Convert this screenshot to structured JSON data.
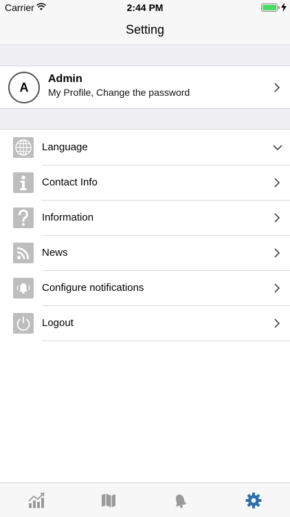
{
  "status": {
    "carrier": "Carrier",
    "time": "2:44 PM"
  },
  "nav": {
    "title": "Setting"
  },
  "profile": {
    "initial": "A",
    "name": "Admin",
    "subtitle": "My Profile, Change the password"
  },
  "menu": [
    {
      "label": "Language",
      "icon": "globe-icon"
    },
    {
      "label": "Contact Info",
      "icon": "info-icon"
    },
    {
      "label": "Information",
      "icon": "question-icon"
    },
    {
      "label": "News",
      "icon": "rss-icon"
    },
    {
      "label": "Configure notifications",
      "icon": "bell-icon"
    },
    {
      "label": "Logout",
      "icon": "power-icon"
    }
  ],
  "tabs": [
    {
      "name": "stats",
      "icon": "chart-icon",
      "active": false
    },
    {
      "name": "map",
      "icon": "map-icon",
      "active": false
    },
    {
      "name": "alerts",
      "icon": "bell-icon",
      "active": false
    },
    {
      "name": "settings",
      "icon": "gear-icon",
      "active": true
    }
  ],
  "colors": {
    "accent": "#2a6fb0",
    "inactive_icon": "#9a9a9a",
    "menu_icon_bg": "#bdbdbd",
    "battery": "#4cd964"
  }
}
